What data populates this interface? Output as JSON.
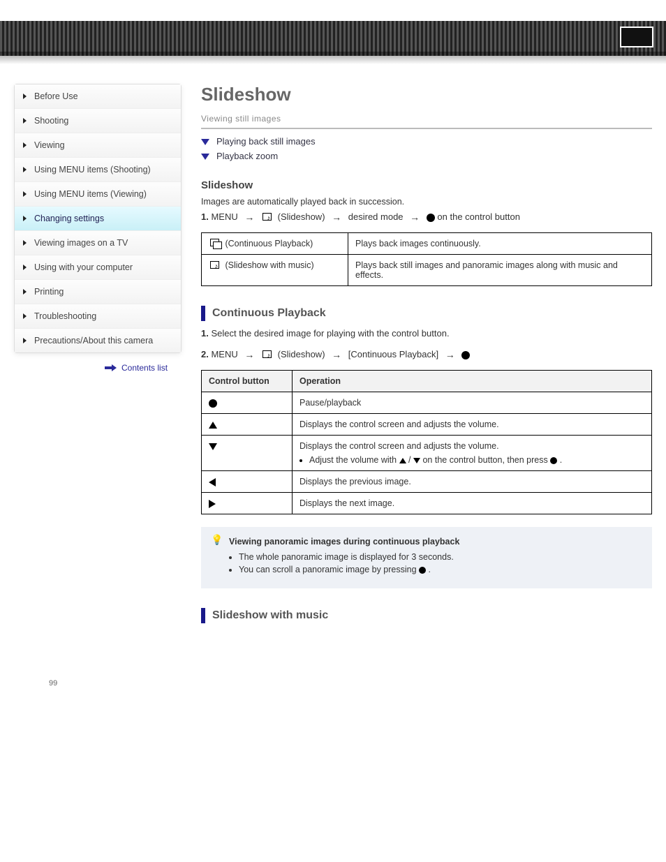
{
  "sidebar": {
    "items": [
      {
        "label": "Before Use"
      },
      {
        "label": "Shooting"
      },
      {
        "label": "Viewing"
      },
      {
        "label": "Using MENU items (Shooting)"
      },
      {
        "label": "Using MENU items (Viewing)"
      },
      {
        "label": "Changing settings"
      },
      {
        "label": "Viewing images on a TV"
      },
      {
        "label": "Using with your computer"
      },
      {
        "label": "Printing"
      },
      {
        "label": "Troubleshooting"
      },
      {
        "label": "Precautions/About this camera"
      }
    ],
    "link": "Contents list"
  },
  "page": {
    "title": "Slideshow",
    "category": "Viewing still images",
    "collapsers": [
      "Playing back still images",
      "Playback zoom"
    ],
    "section1": {
      "heading": "Slideshow",
      "intro": "Images are automatically played back in succession.",
      "step": {
        "num": "1.",
        "pre": "MENU ",
        "mid1": " (Slideshow) ",
        "mid2": " desired mode ",
        "end": " on the control button"
      }
    },
    "table1": {
      "rows": [
        {
          "label": " (Continuous Playback)",
          "desc": "Plays back images continuously."
        },
        {
          "label": " (Slideshow with music)",
          "desc": "Plays back still images and panoramic images along with music and effects."
        }
      ]
    },
    "sub1": {
      "title": "Continuous Playback",
      "step": {
        "num": "1.",
        "pre": "Select the desired image for playing with the control button.",
        "num2": "2.",
        "pre2": "MENU ",
        "mid1": " (Slideshow) ",
        "mid2": " [Continuous Playback] "
      }
    },
    "table2": {
      "head": [
        "Control button",
        "Operation"
      ],
      "rows": [
        {
          "btn": "dot",
          "op": "Pause/playback"
        },
        {
          "btn": "up",
          "op": "Displays the control screen and adjusts the volume."
        },
        {
          "btn": "down",
          "op_pre": "Displays the control screen and adjusts the volume.",
          "note": "Adjust the volume with   /   on the control button, then press  ."
        },
        {
          "btn": "left",
          "op": "Displays the previous image."
        },
        {
          "btn": "right",
          "op": "Displays the next image."
        }
      ]
    },
    "hint": {
      "title": "Viewing panoramic images during continuous playback",
      "lines": [
        "The whole panoramic image is displayed for 3 seconds.",
        "You can scroll a panoramic image by pressing  ."
      ]
    },
    "sub2": {
      "title": "Slideshow with music"
    },
    "pagenum": "99"
  }
}
